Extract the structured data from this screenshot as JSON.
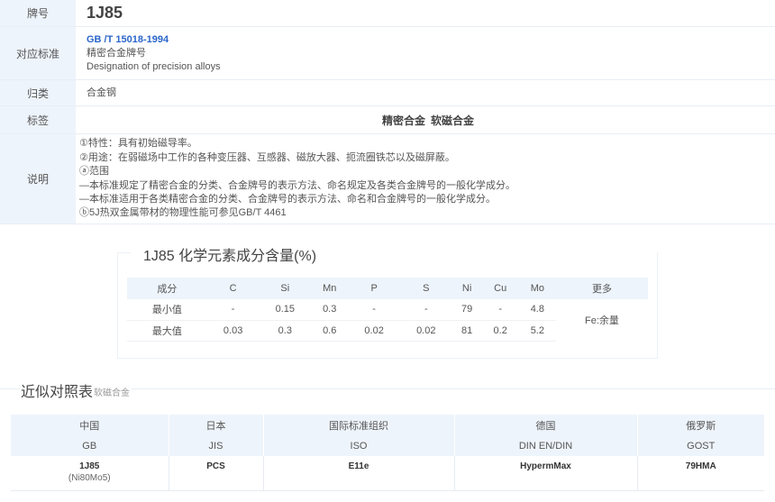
{
  "info": {
    "grade_label": "牌号",
    "grade": "1J85",
    "standard_label": "对应标准",
    "standard_code": "GB /T 15018-1994",
    "standard_name_cn": "精密合金牌号",
    "standard_name_en": "Designation of precision alloys",
    "category_label": "归类",
    "category": "合金钢",
    "tags_label": "标签",
    "tags": [
      "精密合金",
      "软磁合金"
    ],
    "desc_label": "说明",
    "desc_lines": [
      "①特性：具有初始磁导率。",
      "②用途：在弱磁场中工作的各种变压器、互感器、磁放大器、扼流圈铁芯以及磁屏蔽。",
      "ⓐ范围",
      "—本标准规定了精密合金的分类、合金牌号的表示方法、命名规定及各类合金牌号的一般化学成分。",
      "—本标准适用于各类精密合金的分类、合金牌号的表示方法、命名和合金牌号的一般化学成分。",
      "ⓑ5J热双金属带材的物理性能可参见GB/T 4461"
    ]
  },
  "composition": {
    "title": "1J85 化学元素成分含量(%)",
    "headers": [
      "成分",
      "C",
      "Si",
      "Mn",
      "P",
      "S",
      "Ni",
      "Cu",
      "Mo",
      "更多"
    ],
    "rows": [
      {
        "label": "最小值",
        "values": [
          "-",
          "0.15",
          "0.3",
          "-",
          "-",
          "79",
          "-",
          "4.8"
        ]
      },
      {
        "label": "最大值",
        "values": [
          "0.03",
          "0.3",
          "0.6",
          "0.02",
          "0.02",
          "81",
          "0.2",
          "5.2"
        ]
      }
    ],
    "more": "Fe:余量"
  },
  "xref": {
    "title": "近似对照表",
    "subtitle": "软磁合金",
    "countries": [
      "中国",
      "日本",
      "国际标准组织",
      "德国",
      "俄罗斯"
    ],
    "standards": [
      "GB",
      "JIS",
      "ISO",
      "DIN EN/DIN",
      "GOST"
    ],
    "grades": [
      "1J85",
      "PCS",
      "E11e",
      "HypermMax",
      "79HMA"
    ],
    "grade_notes": [
      "(Ni80Mo5)",
      "",
      "",
      "",
      ""
    ]
  }
}
